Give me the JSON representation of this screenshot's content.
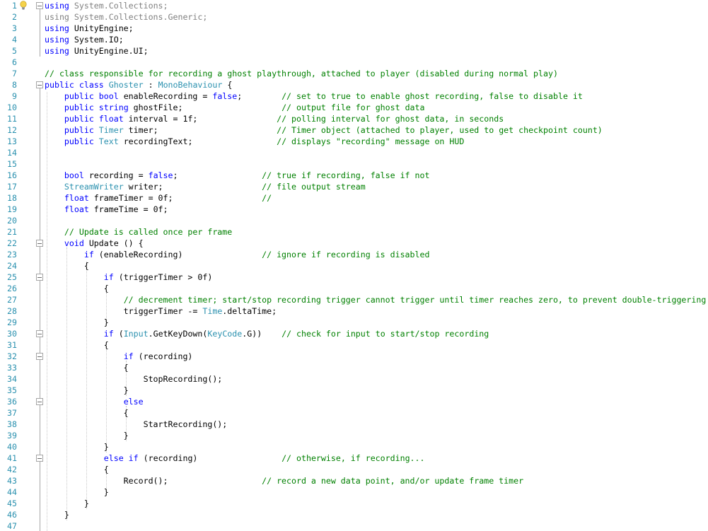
{
  "editor": {
    "colors": {
      "keyword": "#0000ff",
      "type": "#2b91af",
      "comment": "#008000",
      "line_number": "#2b91af",
      "dimmed_using": "#808080"
    },
    "icons": {
      "lightbulb": "lightbulb-icon",
      "fold": "collapse-icon"
    },
    "lines": [
      {
        "n": "1",
        "fold": true,
        "tokens": [
          [
            "kw",
            "using"
          ],
          [
            "ns",
            " System.Collections;"
          ]
        ]
      },
      {
        "n": "2",
        "fold": false,
        "tokens": [
          [
            "ns",
            "using System.Collections.Generic;"
          ]
        ]
      },
      {
        "n": "3",
        "fold": false,
        "tokens": [
          [
            "kw",
            "using"
          ],
          [
            "pl",
            " UnityEngine;"
          ]
        ]
      },
      {
        "n": "4",
        "fold": false,
        "tokens": [
          [
            "kw",
            "using"
          ],
          [
            "pl",
            " System.IO;"
          ]
        ]
      },
      {
        "n": "5",
        "fold": false,
        "tokens": [
          [
            "kw",
            "using"
          ],
          [
            "pl",
            " UnityEngine.UI;"
          ]
        ]
      },
      {
        "n": "6",
        "fold": false,
        "tokens": []
      },
      {
        "n": "7",
        "fold": false,
        "tokens": [
          [
            "cm",
            "// class responsible for recording a ghost playthrough, attached to player (disabled during normal play)"
          ]
        ]
      },
      {
        "n": "8",
        "fold": true,
        "tokens": [
          [
            "kw",
            "public"
          ],
          [
            "pl",
            " "
          ],
          [
            "kw",
            "class"
          ],
          [
            "pl",
            " "
          ],
          [
            "ty",
            "Ghoster"
          ],
          [
            "pl",
            " : "
          ],
          [
            "ty",
            "MonoBehaviour"
          ],
          [
            "pl",
            " {"
          ]
        ]
      },
      {
        "n": "9",
        "fold": false,
        "tokens": [
          [
            "pl",
            "    "
          ],
          [
            "kw",
            "public"
          ],
          [
            "pl",
            " "
          ],
          [
            "kw",
            "bool"
          ],
          [
            "pl",
            " enableRecording = "
          ],
          [
            "kw",
            "false"
          ],
          [
            "pl",
            ";        "
          ],
          [
            "cm",
            "// set to true to enable ghost recording, false to disable it"
          ]
        ]
      },
      {
        "n": "10",
        "fold": false,
        "tokens": [
          [
            "pl",
            "    "
          ],
          [
            "kw",
            "public"
          ],
          [
            "pl",
            " "
          ],
          [
            "kw",
            "string"
          ],
          [
            "pl",
            " ghostFile;                    "
          ],
          [
            "cm",
            "// output file for ghost data"
          ]
        ]
      },
      {
        "n": "11",
        "fold": false,
        "tokens": [
          [
            "pl",
            "    "
          ],
          [
            "kw",
            "public"
          ],
          [
            "pl",
            " "
          ],
          [
            "kw",
            "float"
          ],
          [
            "pl",
            " interval = 1f;                "
          ],
          [
            "cm",
            "// polling interval for ghost data, in seconds"
          ]
        ]
      },
      {
        "n": "12",
        "fold": false,
        "tokens": [
          [
            "pl",
            "    "
          ],
          [
            "kw",
            "public"
          ],
          [
            "pl",
            " "
          ],
          [
            "ty",
            "Timer"
          ],
          [
            "pl",
            " timer;                        "
          ],
          [
            "cm",
            "// Timer object (attached to player, used to get checkpoint count)"
          ]
        ]
      },
      {
        "n": "13",
        "fold": false,
        "tokens": [
          [
            "pl",
            "    "
          ],
          [
            "kw",
            "public"
          ],
          [
            "pl",
            " "
          ],
          [
            "ty",
            "Text"
          ],
          [
            "pl",
            " recordingText;                 "
          ],
          [
            "cm",
            "// displays \"recording\" message on HUD"
          ]
        ]
      },
      {
        "n": "14",
        "fold": false,
        "tokens": []
      },
      {
        "n": "15",
        "fold": false,
        "tokens": []
      },
      {
        "n": "16",
        "fold": false,
        "tokens": [
          [
            "pl",
            "    "
          ],
          [
            "kw",
            "bool"
          ],
          [
            "pl",
            " recording = "
          ],
          [
            "kw",
            "false"
          ],
          [
            "pl",
            ";                 "
          ],
          [
            "cm",
            "// true if recording, false if not"
          ]
        ]
      },
      {
        "n": "17",
        "fold": false,
        "tokens": [
          [
            "pl",
            "    "
          ],
          [
            "ty",
            "StreamWriter"
          ],
          [
            "pl",
            " writer;                    "
          ],
          [
            "cm",
            "// file output stream"
          ]
        ]
      },
      {
        "n": "18",
        "fold": false,
        "tokens": [
          [
            "pl",
            "    "
          ],
          [
            "kw",
            "float"
          ],
          [
            "pl",
            " frameTimer = 0f;                  "
          ],
          [
            "cm",
            "//"
          ]
        ]
      },
      {
        "n": "19",
        "fold": false,
        "tokens": [
          [
            "pl",
            "    "
          ],
          [
            "kw",
            "float"
          ],
          [
            "pl",
            " frameTime = 0f;"
          ]
        ]
      },
      {
        "n": "20",
        "fold": false,
        "tokens": []
      },
      {
        "n": "21",
        "fold": false,
        "tokens": [
          [
            "pl",
            "    "
          ],
          [
            "cm",
            "// Update is called once per frame"
          ]
        ]
      },
      {
        "n": "22",
        "fold": true,
        "tokens": [
          [
            "pl",
            "    "
          ],
          [
            "kw",
            "void"
          ],
          [
            "pl",
            " Update () {"
          ]
        ]
      },
      {
        "n": "23",
        "fold": false,
        "tokens": [
          [
            "pl",
            "        "
          ],
          [
            "kw",
            "if"
          ],
          [
            "pl",
            " (enableRecording)                "
          ],
          [
            "cm",
            "// ignore if recording is disabled"
          ]
        ]
      },
      {
        "n": "24",
        "fold": false,
        "tokens": [
          [
            "pl",
            "        {"
          ]
        ]
      },
      {
        "n": "25",
        "fold": true,
        "tokens": [
          [
            "pl",
            "            "
          ],
          [
            "kw",
            "if"
          ],
          [
            "pl",
            " (triggerTimer > 0f)"
          ]
        ]
      },
      {
        "n": "26",
        "fold": false,
        "tokens": [
          [
            "pl",
            "            {"
          ]
        ]
      },
      {
        "n": "27",
        "fold": false,
        "tokens": [
          [
            "pl",
            "                "
          ],
          [
            "cm",
            "// decrement timer; start/stop recording trigger cannot trigger until timer reaches zero, to prevent double-triggering"
          ]
        ]
      },
      {
        "n": "28",
        "fold": false,
        "tokens": [
          [
            "pl",
            "                triggerTimer -= "
          ],
          [
            "ty",
            "Time"
          ],
          [
            "pl",
            ".deltaTime;"
          ]
        ]
      },
      {
        "n": "29",
        "fold": false,
        "tokens": [
          [
            "pl",
            "            }"
          ]
        ]
      },
      {
        "n": "30",
        "fold": true,
        "tokens": [
          [
            "pl",
            "            "
          ],
          [
            "kw",
            "if"
          ],
          [
            "pl",
            " ("
          ],
          [
            "ty",
            "Input"
          ],
          [
            "pl",
            ".GetKeyDown("
          ],
          [
            "ty",
            "KeyCode"
          ],
          [
            "pl",
            ".G))    "
          ],
          [
            "cm",
            "// check for input to start/stop recording"
          ]
        ]
      },
      {
        "n": "31",
        "fold": false,
        "tokens": [
          [
            "pl",
            "            {"
          ]
        ]
      },
      {
        "n": "32",
        "fold": true,
        "tokens": [
          [
            "pl",
            "                "
          ],
          [
            "kw",
            "if"
          ],
          [
            "pl",
            " (recording)"
          ]
        ]
      },
      {
        "n": "33",
        "fold": false,
        "tokens": [
          [
            "pl",
            "                {"
          ]
        ]
      },
      {
        "n": "34",
        "fold": false,
        "tokens": [
          [
            "pl",
            "                    StopRecording();"
          ]
        ]
      },
      {
        "n": "35",
        "fold": false,
        "tokens": [
          [
            "pl",
            "                }"
          ]
        ]
      },
      {
        "n": "36",
        "fold": true,
        "tokens": [
          [
            "pl",
            "                "
          ],
          [
            "kw",
            "else"
          ]
        ]
      },
      {
        "n": "37",
        "fold": false,
        "tokens": [
          [
            "pl",
            "                {"
          ]
        ]
      },
      {
        "n": "38",
        "fold": false,
        "tokens": [
          [
            "pl",
            "                    StartRecording();"
          ]
        ]
      },
      {
        "n": "39",
        "fold": false,
        "tokens": [
          [
            "pl",
            "                }"
          ]
        ]
      },
      {
        "n": "40",
        "fold": false,
        "tokens": [
          [
            "pl",
            "            }"
          ]
        ]
      },
      {
        "n": "41",
        "fold": true,
        "tokens": [
          [
            "pl",
            "            "
          ],
          [
            "kw",
            "else"
          ],
          [
            "pl",
            " "
          ],
          [
            "kw",
            "if"
          ],
          [
            "pl",
            " (recording)                 "
          ],
          [
            "cm",
            "// otherwise, if recording..."
          ]
        ]
      },
      {
        "n": "42",
        "fold": false,
        "tokens": [
          [
            "pl",
            "            {"
          ]
        ]
      },
      {
        "n": "43",
        "fold": false,
        "tokens": [
          [
            "pl",
            "                Record();                   "
          ],
          [
            "cm",
            "// record a new data point, and/or update frame timer"
          ]
        ]
      },
      {
        "n": "44",
        "fold": false,
        "tokens": [
          [
            "pl",
            "            }"
          ]
        ]
      },
      {
        "n": "45",
        "fold": false,
        "tokens": [
          [
            "pl",
            "        }"
          ]
        ]
      },
      {
        "n": "46",
        "fold": false,
        "tokens": [
          [
            "pl",
            "    }"
          ]
        ]
      },
      {
        "n": "47",
        "fold": false,
        "tokens": []
      }
    ]
  }
}
